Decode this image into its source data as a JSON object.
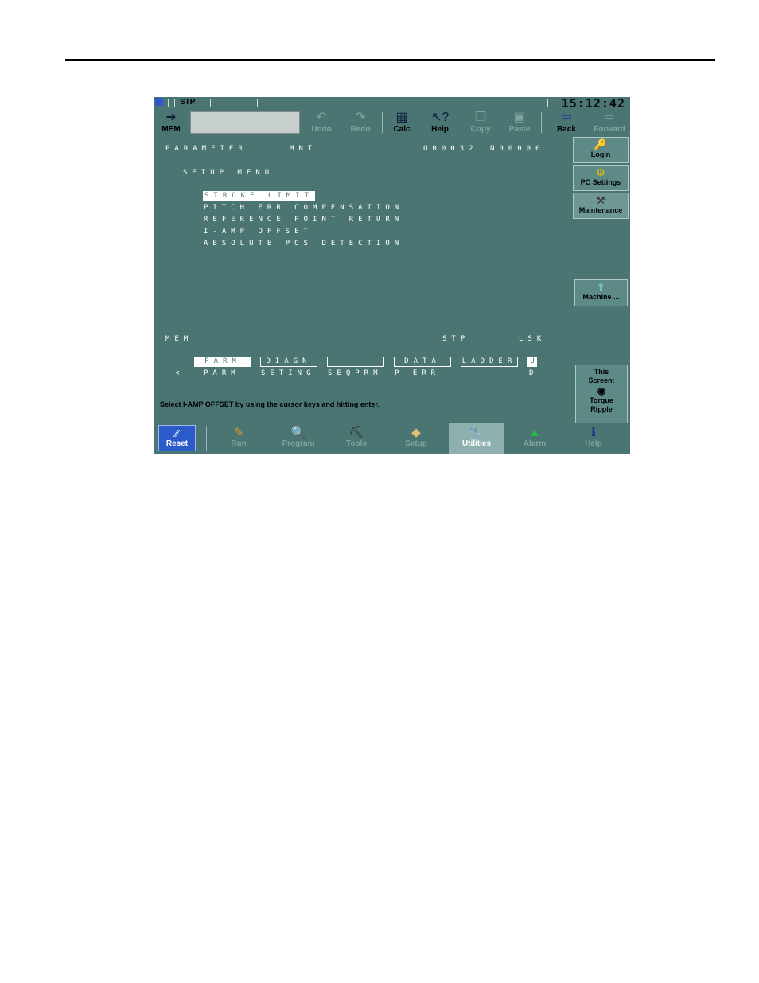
{
  "statusbar": {
    "mode": "STP",
    "clock": "15:12:42"
  },
  "toolbar": {
    "mem_label": "MEM",
    "buttons": [
      {
        "label": "Undo",
        "icon": "undo-icon",
        "enabled": false
      },
      {
        "label": "Redo",
        "icon": "redo-icon",
        "enabled": false
      },
      {
        "label": "Calc",
        "icon": "calculator-icon",
        "enabled": true
      },
      {
        "label": "Help",
        "icon": "help-pointer-icon",
        "enabled": true
      },
      {
        "label": "Copy",
        "icon": "copy-icon",
        "enabled": false
      },
      {
        "label": "Paste",
        "icon": "paste-icon",
        "enabled": false
      },
      {
        "label": "Back",
        "icon": "back-arrow-icon",
        "enabled": true
      },
      {
        "label": "Forward",
        "icon": "forward-arrow-icon",
        "enabled": false
      }
    ]
  },
  "cnc": {
    "header_left": "PARAMETER",
    "header_mode": "MNT",
    "header_o": "O00032",
    "header_n": "N00000",
    "menu_title": "SETUP MENU",
    "menu_items": [
      "STROKE LIMIT",
      "PITCH ERR COMPENSATION",
      "REFERENCE POINT RETURN",
      "I-AMP OFFSET",
      "ABSOLUTE POS DETECTION"
    ],
    "selected_index": 0,
    "status_mem": "MEM",
    "status_stp": "STP",
    "status_lsk": "LSK",
    "softkeys_top": [
      "PARM",
      "DIAGN",
      "",
      "DATA",
      "LADDER",
      "U"
    ],
    "softkeys_bottom": [
      "PARM",
      "SETING",
      "SEQPRM",
      "P ERR",
      "",
      "D"
    ],
    "left_arrow": "<"
  },
  "message": "Select I-AMP OFFSET by using the cursor keys and hitting enter.",
  "side": {
    "login": "Login",
    "pc_settings": "PC Settings",
    "maintenance": "Maintenance",
    "machine": "Machine ...",
    "this_screen": "This Screen:",
    "torque": "Torque Ripple"
  },
  "nav": {
    "reset": "Reset",
    "items": [
      {
        "label": "Run",
        "icon": "run-icon"
      },
      {
        "label": "Program",
        "icon": "program-icon"
      },
      {
        "label": "Tools",
        "icon": "tools-icon"
      },
      {
        "label": "Setup",
        "icon": "setup-icon"
      },
      {
        "label": "Utilities",
        "icon": "wrench-icon"
      },
      {
        "label": "Alarm",
        "icon": "alarm-light-icon"
      },
      {
        "label": "Help",
        "icon": "info-icon"
      }
    ],
    "active": "Utilities"
  }
}
